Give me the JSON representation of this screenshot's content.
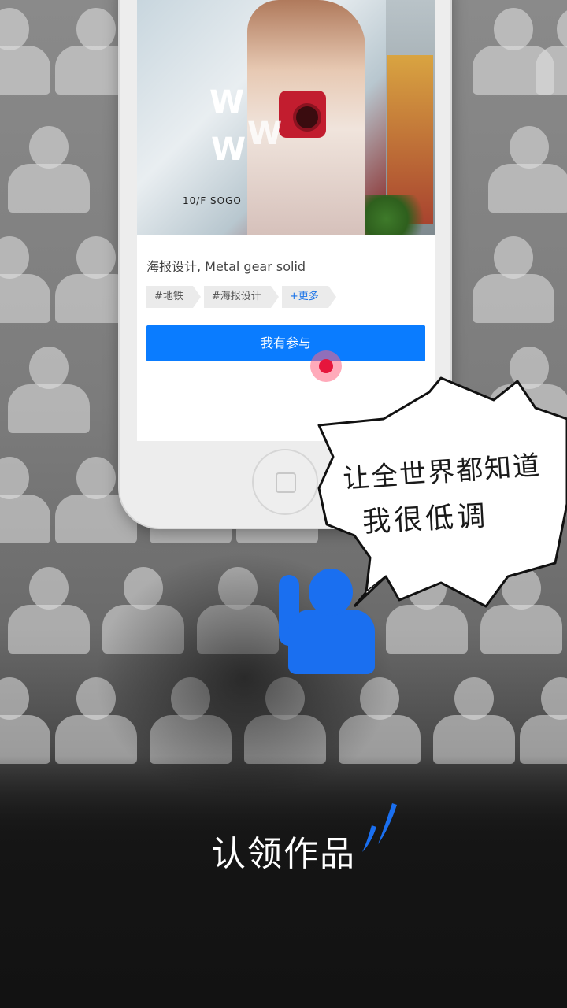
{
  "poster": {
    "sign_text": "10/F SOGO",
    "letters": [
      "W",
      "W",
      "W"
    ]
  },
  "card": {
    "title": "海报设计, Metal gear solid",
    "tags": [
      {
        "label": "#地铁"
      },
      {
        "label": "#海报设计"
      },
      {
        "label": "+更多"
      }
    ],
    "join_button": "我有参与"
  },
  "bubble": {
    "line1": "让全世界都知道",
    "line2": "我很低调"
  },
  "caption": "认领作品",
  "colors": {
    "accent": "#0a7cff",
    "person_highlight": "#1a6ff0",
    "tap_indicator": "#e6163c"
  }
}
